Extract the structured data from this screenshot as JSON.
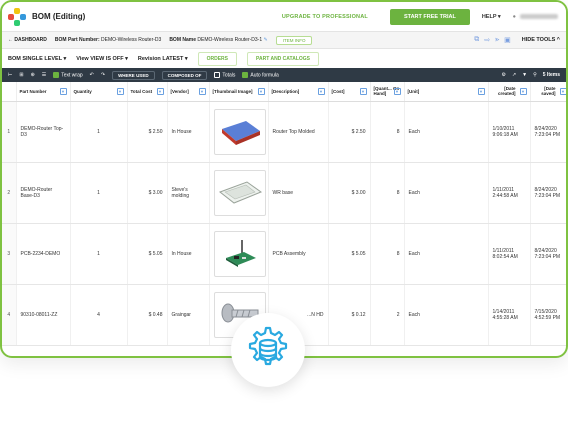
{
  "header": {
    "app_title": "BOM (Editing)",
    "upgrade_label": "UPGRADE TO PROFESSIONAL",
    "trial_label": "START FREE TRIAL",
    "help_label": "HELP ▾",
    "brand_colors": {
      "green": "#6cb33f",
      "dark": "#2f3a45",
      "frame": "#7fc241"
    }
  },
  "breadcrumb": {
    "dashboard": "← DASHBOARD",
    "bom_part_number_label": "BOM Part Number:",
    "bom_part_number_value": "DEMO-Wireless Router-D3",
    "bom_name_label": "BOM Name",
    "bom_name_value": "DEMO-Wireless Router-D3-1",
    "item_info_label": "ITEM INFO",
    "hide_tools_label": "HIDE TOOLS ^"
  },
  "level_row": {
    "bom_level": "BOM SINGLE LEVEL ▾",
    "view_label": "View",
    "view_value": "VIEW IS OFF ▾",
    "revision_label": "Revision",
    "revision_value": "LATEST ▾",
    "orders_label": "ORDERS",
    "part_catalogs_label": "PART AND CATALOGS"
  },
  "toolbar": {
    "text_wrap_label": "Text wrap",
    "where_used_label": "WHERE USED",
    "composed_of_label": "COMPOSED OF",
    "totals_label": "Totals",
    "auto_formula_label": "Auto formula",
    "items_count": "5 Items"
  },
  "table": {
    "columns": [
      "Part Number",
      "Quantity",
      "Total Cost",
      "[Vendor]",
      "[Thumbnail Image]",
      "[Description]",
      "[Cost]",
      "[Quant... On Hand]",
      "[Unit]",
      "[Date created]",
      "[Date saved]"
    ],
    "rows": [
      {
        "idx": "1",
        "part_number": "DEMO-Router Top-D3",
        "quantity": "1",
        "total_cost": "$ 2.50",
        "vendor": "In House",
        "thumb": "router-top-icon",
        "description": "Router Top Molded",
        "cost": "$ 2.50",
        "on_hand": "8",
        "unit": "Each",
        "date_created": "1/10/2011 9:06:18 AM",
        "date_saved": "8/24/2020 7:23:04 PM"
      },
      {
        "idx": "2",
        "part_number": "DEMO-Router Base-D3",
        "quantity": "1",
        "total_cost": "$ 3.00",
        "vendor": "Steve's molding",
        "thumb": "router-base-icon",
        "description": "WR base",
        "cost": "$ 3.00",
        "on_hand": "8",
        "unit": "Each",
        "date_created": "1/11/2011 2:44:58 AM",
        "date_saved": "8/24/2020 7:23:04 PM"
      },
      {
        "idx": "3",
        "part_number": "PCB-2234-DEMO",
        "quantity": "1",
        "total_cost": "$ 5.05",
        "vendor": "In House",
        "thumb": "pcb-icon",
        "description": "PCB Assembly",
        "cost": "$ 5.05",
        "on_hand": "8",
        "unit": "Each",
        "date_created": "1/11/2011 8:02:54 AM",
        "date_saved": "8/24/2020 7:23:04 PM"
      },
      {
        "idx": "4",
        "part_number": "90310-08011-ZZ",
        "quantity": "4",
        "total_cost": "$ 0.48",
        "vendor": "Graingar",
        "thumb": "screw-icon",
        "description": "...N HD",
        "cost": "$ 0.12",
        "on_hand": "2",
        "unit": "Each",
        "date_created": "1/14/2011 4:55:28 AM",
        "date_saved": "7/15/2020 4:52:59 PM"
      }
    ]
  },
  "badge": {
    "icon": "database-gear-icon"
  }
}
